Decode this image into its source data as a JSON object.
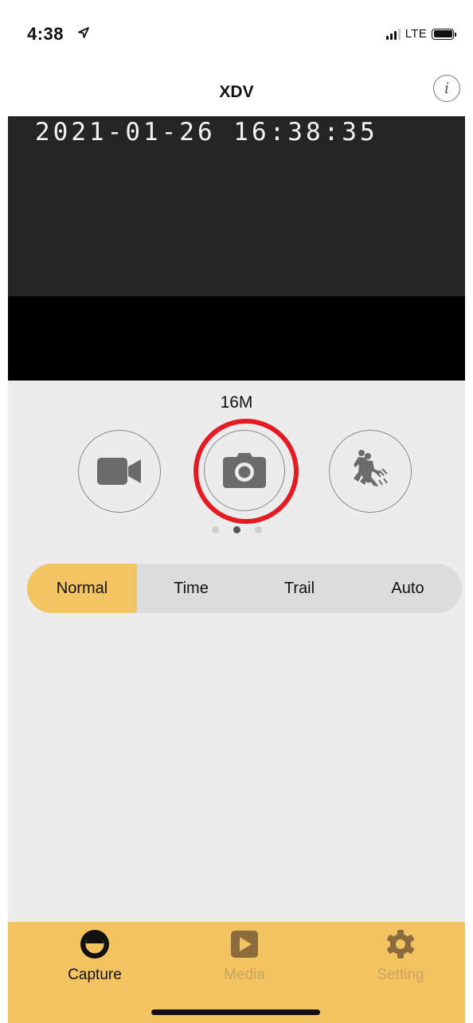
{
  "status_bar": {
    "time": "4:38",
    "location_icon": "location-arrow-icon",
    "network": "LTE",
    "signal_icon": "cellular-signal-icon",
    "battery_icon": "battery-icon"
  },
  "nav": {
    "title": "XDV",
    "info_icon": "info-icon",
    "info_glyph": "i"
  },
  "preview": {
    "timestamp": "2021-01-26 16:38:35"
  },
  "capture": {
    "resolution": "16M",
    "modes": [
      {
        "name": "video",
        "icon": "video-camera-icon"
      },
      {
        "name": "photo",
        "icon": "camera-icon",
        "selected": true
      },
      {
        "name": "burst",
        "icon": "burst-runner-icon"
      }
    ],
    "page_dots": 3,
    "active_dot": 2,
    "highlight_color": "#e41b22"
  },
  "segments": {
    "items": [
      "Normal",
      "Time",
      "Trail",
      "Auto"
    ],
    "selected": "Normal"
  },
  "tabs": {
    "items": [
      {
        "label": "Capture",
        "icon": "capture-lens-icon",
        "active": true
      },
      {
        "label": "Media",
        "icon": "play-icon",
        "active": false
      },
      {
        "label": "Setting",
        "icon": "gear-icon",
        "active": false
      }
    ]
  },
  "colors": {
    "accent": "#f3c462",
    "tab_bar": "#f3c362",
    "inactive_tab": "#c9a55e",
    "preview_bg": "#262526",
    "page_bg": "#ececec"
  }
}
